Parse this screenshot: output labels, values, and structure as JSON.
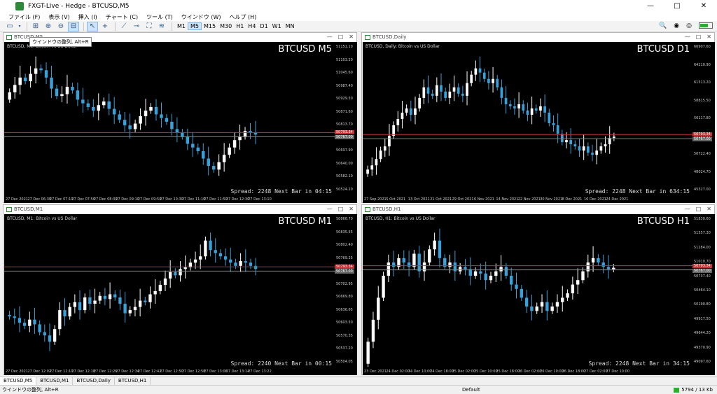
{
  "window": {
    "title": "FXGT-Live - Hedge - BTCUSD,M5",
    "controls": [
      "—",
      "□",
      "✕"
    ]
  },
  "menu": [
    "ファイル (F)",
    "表示 (V)",
    "挿入 (I)",
    "チャート (C)",
    "ツール (T)",
    "ウインドウ (W)",
    "ヘルプ (H)"
  ],
  "toolbar": {
    "timeframes": [
      "M1",
      "M5",
      "M15",
      "M30",
      "H1",
      "H4",
      "D1",
      "W1",
      "MN"
    ],
    "active_timeframe": "M5",
    "tooltip": "ウインドウの整列, Alt+R",
    "signal_level": 0.6
  },
  "charts": [
    {
      "window_title": "BTCUSD,M5",
      "symbol_desc": "BTCUSD, M5: Bitcoin vs US Dollar",
      "symbol": "BTCUSD M5",
      "spread_text": "Spread: 2248 Next Bar in 04:15",
      "y_ticks": [
        "51151.10",
        "51103.20",
        "51045.60",
        "50987.40",
        "50929.50",
        "50871.60",
        "50813.70",
        "50755.80",
        "50697.90",
        "50640.00",
        "50582.10",
        "50524.20"
      ],
      "x_ticks": [
        "27 Dec 2021",
        "27 Dec 06:30",
        "27 Dec 07:10",
        "27 Dec 07:50",
        "27 Dec 08:30",
        "27 Dec 09:10",
        "27 Dec 09:50",
        "27 Dec 10:30",
        "27 Dec 11:10",
        "27 Dec 11:50",
        "27 Dec 12:30",
        "27 Dec 13:10"
      ],
      "ask_label": "50793.34",
      "bid_label": "50767.00",
      "chart_data": {
        "type": "candlestick",
        "close": [
          51000,
          51040,
          51080,
          51060,
          51100,
          51130,
          51120,
          51080,
          51020,
          50980,
          50990,
          51030,
          51010,
          50960,
          50940,
          50920,
          50900,
          50930,
          50950,
          50910,
          50880,
          50850,
          50820,
          50800,
          50830,
          50870,
          50900,
          50920,
          50880,
          50860,
          50840,
          50800,
          50780,
          50760,
          50720,
          50700,
          50680,
          50640,
          50600,
          50580,
          50620,
          50660,
          50700,
          50740,
          50760,
          50790,
          50780,
          50770
        ]
      }
    },
    {
      "window_title": "BTCUSD,Daily",
      "symbol_desc": "BTCUSD, Daily: Bitcoin vs US Dollar",
      "symbol": "BTCUSD D1",
      "spread_text": "Spread: 2248 Next Bar in 634:15",
      "y_ticks": [
        "66907.60",
        "64210.90",
        "61513.20",
        "58815.50",
        "56117.80",
        "53420.10",
        "50722.40",
        "48024.70",
        "45327.00"
      ],
      "x_ticks": [
        "27 Sep 2021",
        "5 Oct 2021",
        "13 Oct 2021",
        "21 Oct 2021",
        "29 Oct 2021",
        "6 Nov 2021",
        "14 Nov 2021",
        "22 Nov 2021",
        "30 Nov 2021",
        "8 Dec 2021",
        "16 Dec 2021",
        "24 Dec 2021"
      ],
      "ask_label": "50793.34",
      "bid_label": "50767.00",
      "chart_data": {
        "type": "candlestick",
        "close": [
          43000,
          44000,
          45500,
          47500,
          48500,
          51000,
          53500,
          55000,
          56500,
          57500,
          56000,
          57500,
          60000,
          62500,
          61000,
          60500,
          63000,
          61500,
          60000,
          61500,
          62500,
          61000,
          60500,
          63500,
          65500,
          67000,
          66000,
          64500,
          63500,
          64500,
          62500,
          60000,
          58500,
          58000,
          57500,
          58500,
          57000,
          56000,
          57500,
          57000,
          58000,
          56500,
          54000,
          53500,
          51500,
          49500,
          50000,
          49000,
          48500,
          47500,
          48500,
          47000,
          46500,
          47500,
          48500,
          49000,
          50500,
          50800
        ]
      }
    },
    {
      "window_title": "BTCUSD,M1",
      "symbol_desc": "BTCUSD, M1: Bitcoin vs US Dollar",
      "symbol": "BTCUSD M1",
      "spread_text": "Spread: 2240 Next Bar in 00:15",
      "y_ticks": [
        "50868.70",
        "50835.55",
        "50802.40",
        "50769.25",
        "50736.10",
        "50702.95",
        "50669.80",
        "50636.65",
        "50603.50",
        "50570.35",
        "50537.20",
        "50504.05"
      ],
      "x_ticks": [
        "27 Dec 2021",
        "27 Dec 12:02",
        "27 Dec 12:10",
        "27 Dec 12:18",
        "27 Dec 12:26",
        "27 Dec 12:34",
        "27 Dec 12:42",
        "27 Dec 12:50",
        "27 Dec 12:58",
        "27 Dec 13:06",
        "27 Dec 13:14",
        "27 Dec 13:22"
      ],
      "ask_label": "50793.34",
      "bid_label": "50767.00",
      "chart_data": {
        "type": "candlestick",
        "close": [
          50620,
          50615,
          50600,
          50590,
          50610,
          50595,
          50570,
          50560,
          50540,
          50580,
          50640,
          50620,
          50650,
          50665,
          50640,
          50680,
          50660,
          50670,
          50685,
          50675,
          50690,
          50680,
          50660,
          50630,
          50640,
          50650,
          50670,
          50665,
          50690,
          50700,
          50720,
          50740,
          50760,
          50750,
          50770,
          50775,
          50790,
          50800,
          50810,
          50860,
          50830,
          50820,
          50810,
          50800,
          50790,
          50780,
          50795,
          50790,
          50780,
          50770
        ]
      }
    },
    {
      "window_title": "BTCUSD,H1",
      "symbol_desc": "BTCUSD, H1: Bitcoin vs US Dollar",
      "symbol": "BTCUSD H1",
      "spread_text": "Spread: 2248 Next Bar in 34:15",
      "y_ticks": [
        "51830.60",
        "51557.30",
        "51284.00",
        "51010.70",
        "50737.40",
        "50464.10",
        "50190.80",
        "49917.50",
        "49644.20",
        "49370.90",
        "49097.60"
      ],
      "x_ticks": [
        "23 Dec 2021",
        "24 Dec 02:00",
        "24 Dec 10:00",
        "24 Dec 18:00",
        "25 Dec 02:00",
        "25 Dec 10:00",
        "25 Dec 18:00",
        "26 Dec 02:00",
        "26 Dec 10:00",
        "26 Dec 18:00",
        "27 Dec 02:00",
        "27 Dec 10:00"
      ],
      "ask_label": "50793.34",
      "bid_label": "50767.00",
      "chart_data": {
        "type": "candlestick",
        "close": [
          49100,
          49600,
          50100,
          50600,
          50900,
          50800,
          51000,
          50900,
          50800,
          51100,
          50700,
          50900,
          51200,
          51400,
          51000,
          50800,
          50900,
          50700,
          50800,
          50750,
          50600,
          50700,
          50650,
          50500,
          50600,
          50700,
          50800,
          50600,
          50400,
          50300,
          50100,
          49900,
          49800,
          49900,
          50000,
          49800,
          49900,
          50000,
          50100,
          50200,
          50400,
          50500,
          50700,
          50900,
          51000,
          50900,
          50800,
          50750,
          50780
        ]
      }
    }
  ],
  "tabs": [
    "BTCUSD,M5",
    "BTCUSD,M1",
    "BTCUSD,Daily",
    "BTCUSD,H1"
  ],
  "active_tab": "BTCUSD,M5",
  "status": {
    "left": "ウインドウの整列, Alt+R",
    "profile": "Default",
    "traffic": "5794 / 13 Kb"
  },
  "colors": {
    "bull": "#ffffff",
    "bear": "#3aa0d8",
    "ask_line": "#c83232",
    "bid_line": "#888888",
    "chart_bg": "#000000"
  }
}
